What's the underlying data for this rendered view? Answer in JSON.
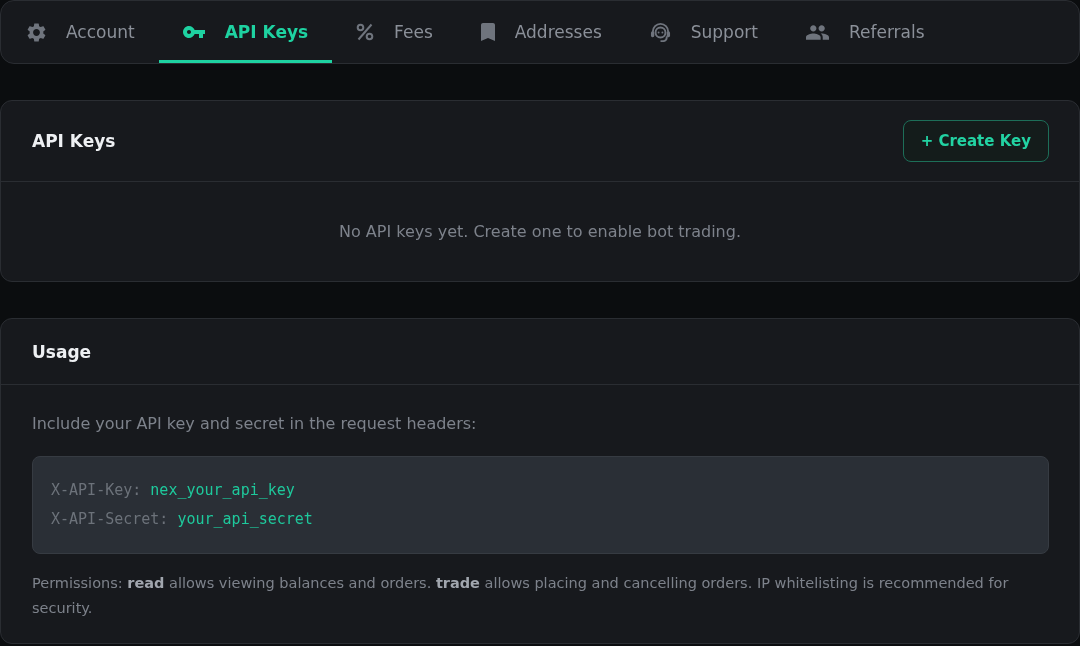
{
  "tabs": [
    {
      "label": "Account",
      "selected": false
    },
    {
      "label": "API Keys",
      "selected": true
    },
    {
      "label": "Fees",
      "selected": false
    },
    {
      "label": "Addresses",
      "selected": false
    },
    {
      "label": "Support",
      "selected": false
    },
    {
      "label": "Referrals",
      "selected": false
    }
  ],
  "api_keys": {
    "title": "API Keys",
    "create_button": "+ Create Key",
    "empty_message": "No API keys yet. Create one to enable bot trading."
  },
  "usage": {
    "title": "Usage",
    "intro": "Include your API key and secret in the request headers:",
    "code_lines": [
      {
        "header": "X-API-Key:",
        "value": "nex_your_api_key"
      },
      {
        "header": "X-API-Secret:",
        "value": "your_api_secret"
      }
    ],
    "note": "Permissions: **read** allows viewing balances and orders. **trade** allows placing and cancelling orders. IP whitelisting is recommended for security."
  }
}
